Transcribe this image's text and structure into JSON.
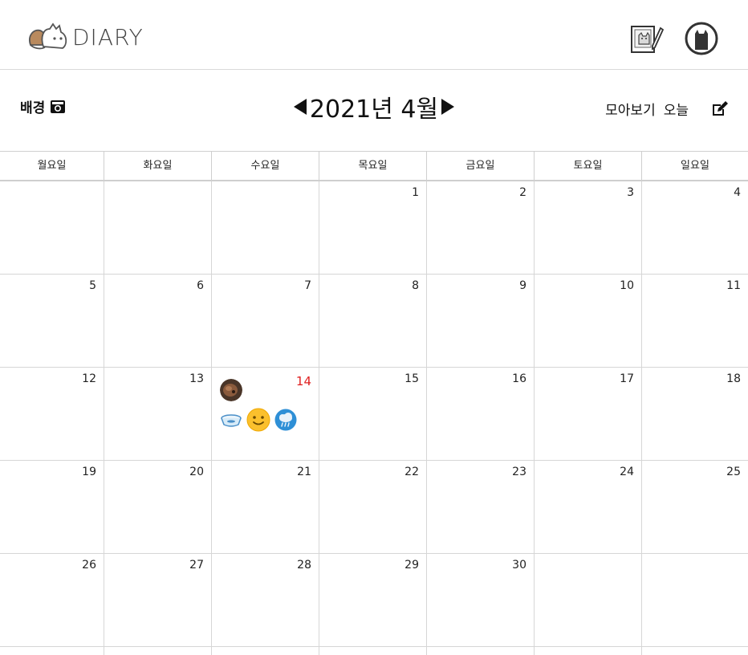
{
  "app": {
    "title": "DIARY"
  },
  "header": {
    "write_icon": "diary-write-icon",
    "profile_icon": "cat-profile-icon"
  },
  "toolbar": {
    "background_label": "배경",
    "background_icon": "camera-icon",
    "month_title": "◀2021년 4월▶",
    "month_label": "2021년 4월",
    "collect_label": "모아보기",
    "today_label": "오늘",
    "edit_icon": "edit-icon"
  },
  "calendar": {
    "weekdays": [
      "월요일",
      "화요일",
      "수요일",
      "목요일",
      "금요일",
      "토요일",
      "일요일"
    ],
    "weeks": [
      [
        "",
        "",
        "",
        "1",
        "2",
        "3",
        "4"
      ],
      [
        "5",
        "6",
        "7",
        "8",
        "9",
        "10",
        "11"
      ],
      [
        "12",
        "13",
        "14",
        "15",
        "16",
        "17",
        "18"
      ],
      [
        "19",
        "20",
        "21",
        "22",
        "23",
        "24",
        "25"
      ],
      [
        "26",
        "27",
        "28",
        "29",
        "30",
        "",
        ""
      ]
    ],
    "today": "14",
    "today_color": "#e02020",
    "entry": {
      "day": "14",
      "icons": [
        "pet-photo-thumbnail",
        "food-bowl-icon",
        "smiley-mood-icon",
        "rain-weather-icon"
      ]
    }
  }
}
